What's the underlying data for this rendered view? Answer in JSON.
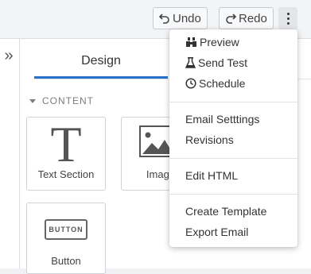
{
  "toolbar": {
    "undo_label": "Undo",
    "redo_label": "Redo",
    "more_icon": "vertical-ellipsis-icon"
  },
  "sidebar": {
    "collapse_icon": "double-chevron-right-icon",
    "collapse_glyph": "»"
  },
  "tabs": {
    "design_label": "Design"
  },
  "content_section": {
    "title": "CONTENT",
    "cards": [
      {
        "label": "Text Section",
        "icon": "text-icon",
        "glyph": "T"
      },
      {
        "label": "Image",
        "icon": "image-icon"
      },
      {
        "label": "Button",
        "icon": "button-icon",
        "icon_text": "BUTTON"
      }
    ]
  },
  "dropdown_menu": {
    "items": [
      {
        "label": "Preview",
        "icon": "binoculars-icon"
      },
      {
        "label": "Send Test",
        "icon": "flask-icon"
      },
      {
        "label": "Schedule",
        "icon": "clock-icon"
      },
      {
        "label": "Email Setttings"
      },
      {
        "label": "Revisions"
      },
      {
        "label": "Edit HTML"
      },
      {
        "label": "Create Template"
      },
      {
        "label": "Export Email"
      }
    ]
  },
  "colors": {
    "accent": "#2a6fc9",
    "background": "#f0f1f3",
    "menu_bg": "#ffffff"
  }
}
